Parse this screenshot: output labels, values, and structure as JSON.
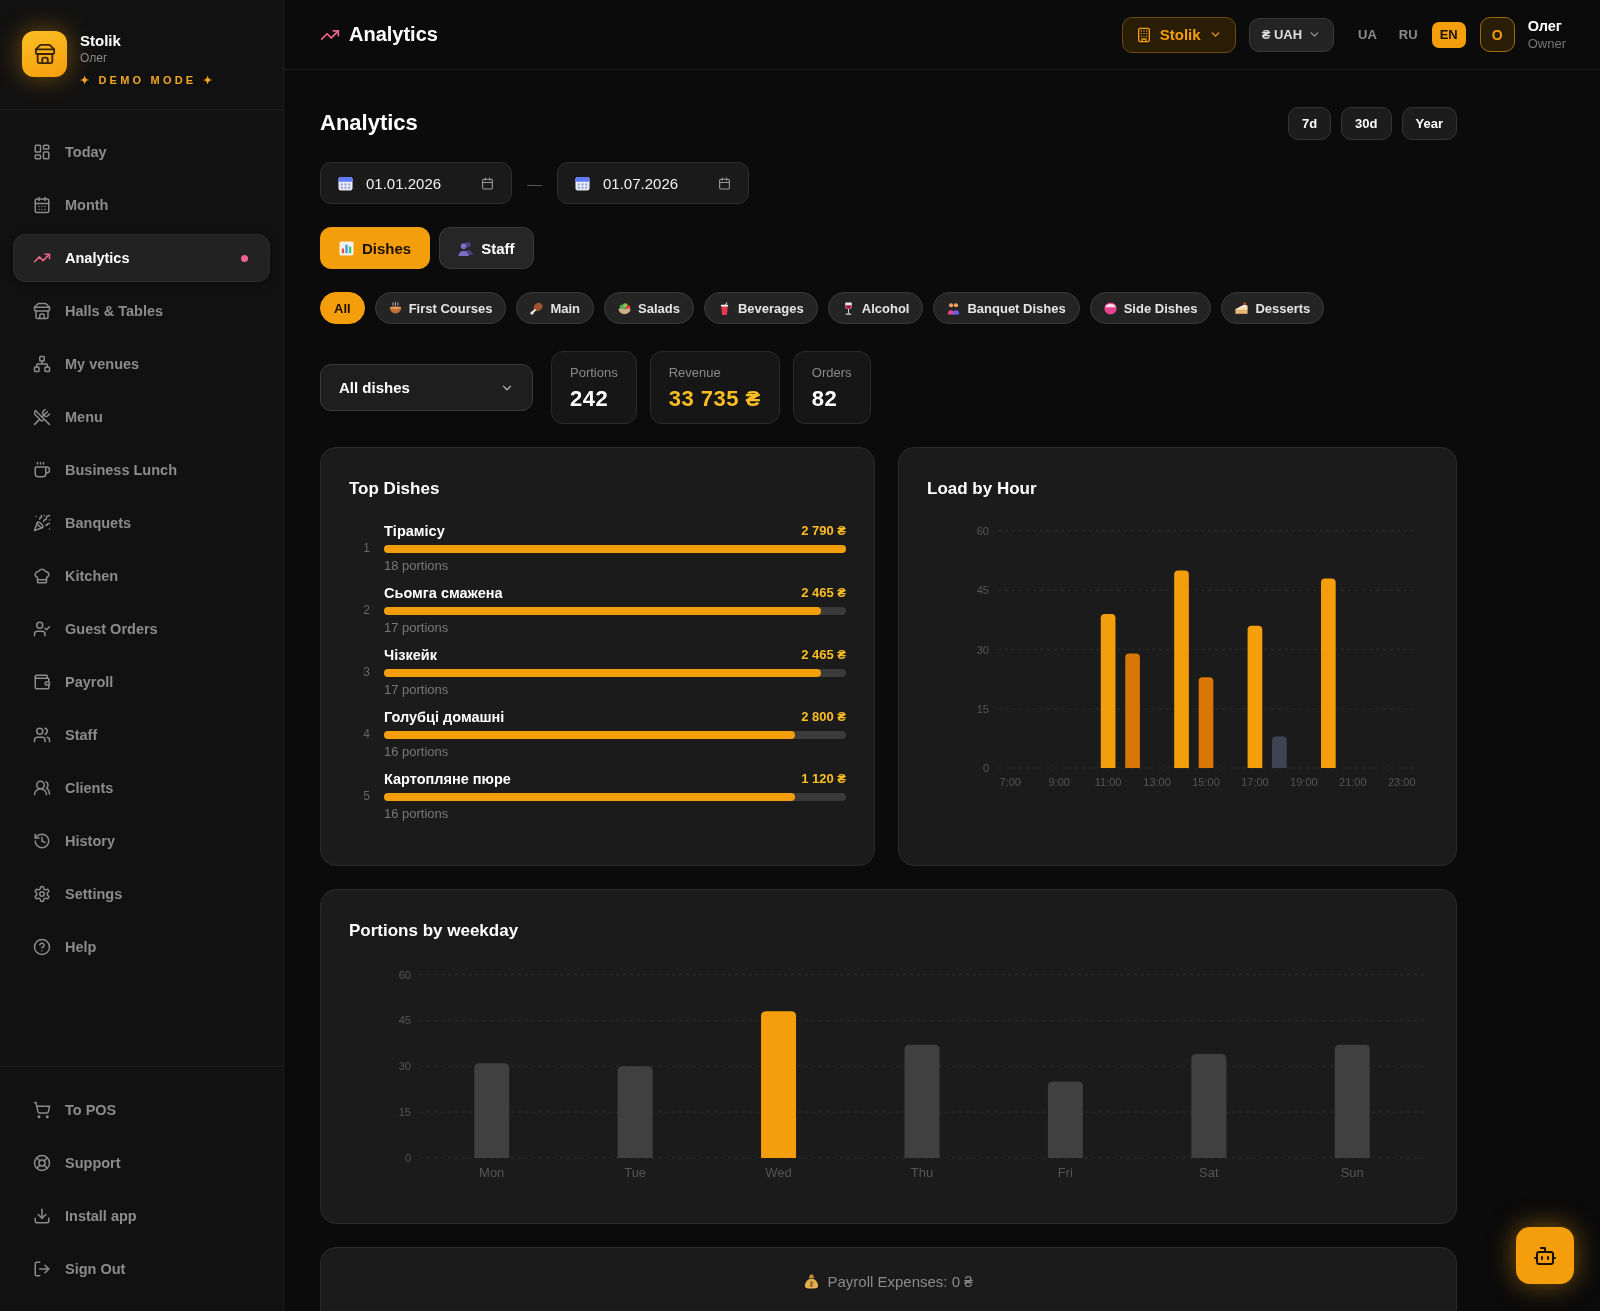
{
  "sidebar": {
    "brand": {
      "name": "Stolik",
      "user": "Олег",
      "badge": "✦ DEMO MODE ✦"
    },
    "items": [
      {
        "label": "Today",
        "selected": false
      },
      {
        "label": "Month",
        "selected": false
      },
      {
        "label": "Analytics",
        "selected": true
      },
      {
        "label": "Halls & Tables",
        "selected": false
      },
      {
        "label": "My venues",
        "selected": false
      },
      {
        "label": "Menu",
        "selected": false
      },
      {
        "label": "Business Lunch",
        "selected": false
      },
      {
        "label": "Banquets",
        "selected": false
      },
      {
        "label": "Kitchen",
        "selected": false
      },
      {
        "label": "Guest Orders",
        "selected": false
      },
      {
        "label": "Payroll",
        "selected": false
      },
      {
        "label": "Staff",
        "selected": false
      },
      {
        "label": "Clients",
        "selected": false
      },
      {
        "label": "History",
        "selected": false
      },
      {
        "label": "Settings",
        "selected": false
      },
      {
        "label": "Help",
        "selected": false
      }
    ],
    "footer_items": [
      {
        "label": "To POS"
      },
      {
        "label": "Support"
      },
      {
        "label": "Install app"
      },
      {
        "label": "Sign Out"
      }
    ]
  },
  "header": {
    "title": "Analytics",
    "venue": "Stolik",
    "currency": "₴ UAH",
    "languages": [
      {
        "label": "UA",
        "selected": false
      },
      {
        "label": "RU",
        "selected": false
      },
      {
        "label": "EN",
        "selected": true
      }
    ],
    "user": {
      "initial": "О",
      "name": "Олег",
      "role": "Owner"
    }
  },
  "page": {
    "title": "Analytics",
    "periods": [
      {
        "label": "7d",
        "selected": false
      },
      {
        "label": "30d",
        "selected": false
      },
      {
        "label": "Year",
        "selected": false
      }
    ]
  },
  "date_range": {
    "from": "01.01.2026",
    "separator": "—",
    "to": "01.07.2026"
  },
  "view_tabs": [
    {
      "label": "Dishes",
      "selected": true
    },
    {
      "label": "Staff",
      "selected": false
    }
  ],
  "categories": [
    {
      "label": "All",
      "selected": true
    },
    {
      "label": "First Courses",
      "selected": false
    },
    {
      "label": "Main",
      "selected": false
    },
    {
      "label": "Salads",
      "selected": false
    },
    {
      "label": "Beverages",
      "selected": false
    },
    {
      "label": "Alcohol",
      "selected": false
    },
    {
      "label": "Banquet Dishes",
      "selected": false
    },
    {
      "label": "Side Dishes",
      "selected": false
    },
    {
      "label": "Desserts",
      "selected": false
    }
  ],
  "dish_select": {
    "value": "All dishes"
  },
  "stats": [
    {
      "label": "Portions",
      "value": "242",
      "kind": "count"
    },
    {
      "label": "Revenue",
      "value": "33 735 ₴",
      "kind": "money"
    },
    {
      "label": "Orders",
      "value": "82",
      "kind": "count"
    }
  ],
  "top_dishes": {
    "title": "Top Dishes",
    "items": [
      {
        "rank": "1",
        "name": "Тірамісу",
        "revenue": "2 790 ₴",
        "level": 1.0,
        "portions": "18 portions"
      },
      {
        "rank": "2",
        "name": "Сьомга смажена",
        "revenue": "2 465 ₴",
        "level": 0.945,
        "portions": "17 portions"
      },
      {
        "rank": "3",
        "name": "Чізкейк",
        "revenue": "2 465 ₴",
        "level": 0.945,
        "portions": "17 portions"
      },
      {
        "rank": "4",
        "name": "Голубці домашні",
        "revenue": "2 800 ₴",
        "level": 0.89,
        "portions": "16 portions"
      },
      {
        "rank": "5",
        "name": "Картопляне пюре",
        "revenue": "1 120 ₴",
        "level": 0.89,
        "portions": "16 portions"
      }
    ]
  },
  "load_by_hour": {
    "chart_data": {
      "type": "bar",
      "title": "Load by Hour",
      "x": [
        11,
        12,
        14,
        15,
        17,
        18,
        20
      ],
      "series": [
        {
          "color": "#f59e0b",
          "values": [
            39,
            null,
            50,
            null,
            36,
            null,
            48
          ]
        },
        {
          "color": "#d97706",
          "values": [
            null,
            29,
            null,
            23,
            null,
            null,
            null
          ]
        },
        {
          "color": "#3d4454",
          "values": [
            null,
            null,
            null,
            null,
            null,
            8,
            null
          ]
        }
      ],
      "xlim": [
        6.5,
        23.5
      ],
      "ylim": [
        0,
        60
      ],
      "yticks": [
        0,
        15,
        30,
        45,
        60
      ],
      "xticks": [
        {
          "value": 7,
          "label": "7:00"
        },
        {
          "value": 9,
          "label": "9:00"
        },
        {
          "value": 11,
          "label": "11:00"
        },
        {
          "value": 13,
          "label": "13:00"
        },
        {
          "value": 15,
          "label": "15:00"
        },
        {
          "value": 17,
          "label": "17:00"
        },
        {
          "value": 19,
          "label": "19:00"
        },
        {
          "value": 21,
          "label": "21:00"
        },
        {
          "value": 23,
          "label": "23:00"
        }
      ],
      "grid": true
    }
  },
  "portions_by_weekday": {
    "chart_data": {
      "type": "bar",
      "title": "Portions by weekday",
      "categories": [
        "Mon",
        "Tue",
        "Wed",
        "Thu",
        "Fri",
        "Sat",
        "Sun"
      ],
      "series": [
        {
          "color": "#f59e0b",
          "values": [
            null,
            null,
            48,
            null,
            null,
            null,
            null
          ]
        },
        {
          "color": "#404040",
          "values": [
            31,
            30,
            null,
            37,
            25,
            34,
            37
          ]
        }
      ],
      "ylim": [
        0,
        60
      ],
      "yticks": [
        0,
        15,
        30,
        45,
        60
      ],
      "grid": true
    }
  },
  "payroll": {
    "text": "Payroll Expenses: 0 ₴"
  }
}
